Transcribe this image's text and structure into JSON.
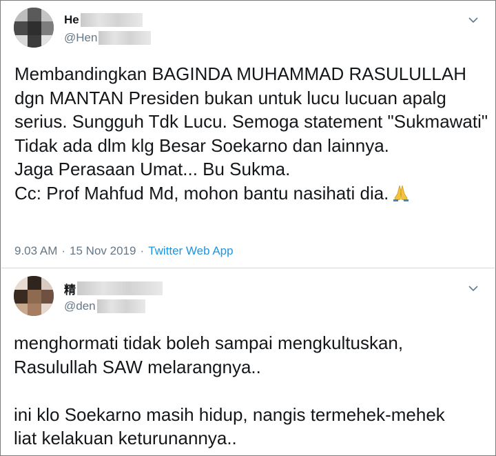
{
  "tweets": [
    {
      "display_name": "He",
      "handle": "@Hen",
      "text": "Membandingkan BAGINDA MUHAMMAD RASULULLAH dgn MANTAN Presiden bukan untuk lucu lucuan apalg serius. Sungguh Tdk Lucu. Semoga statement \"Sukmawati\" Tidak ada dlm klg Besar Soekarno dan lainnya.\nJaga Perasaan Umat... Bu Sukma.\nCc: Prof Mahfud Md, mohon bantu nasihati dia.",
      "emoji_icon": "folded-hands-icon",
      "time": "9.03 AM",
      "separator": "·",
      "date": "15 Nov 2019",
      "source": "Twitter Web App"
    },
    {
      "display_name": "精",
      "handle": "@den",
      "text": "menghormati tidak boleh sampai mengkultuskan,\nRasulullah SAW melarangnya..\n\nini klo Soekarno masih hidup, nangis termehek-mehek\nliat kelakuan keturunannya.."
    }
  ],
  "icons": {
    "menu": "chevron-down-icon"
  },
  "colors": {
    "link": "#1b95e0",
    "secondary": "#657786",
    "text": "#14171a",
    "divider": "#d6d6d6"
  }
}
